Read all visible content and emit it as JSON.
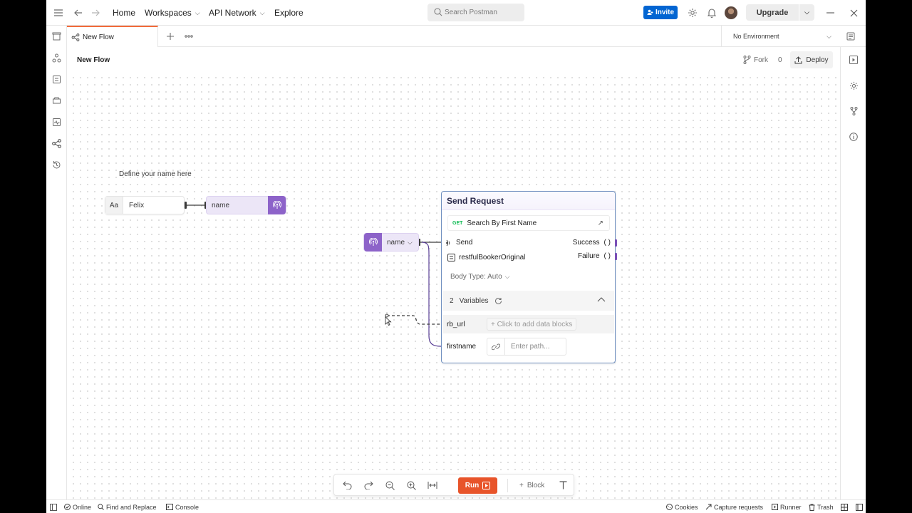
{
  "topbar": {
    "nav": [
      "Home",
      "Workspaces",
      "API Network",
      "Explore"
    ],
    "search_placeholder": "Search Postman",
    "invite_label": "Invite",
    "upgrade_label": "Upgrade"
  },
  "tabs": {
    "active_tab": "New Flow",
    "environment": "No Environment"
  },
  "flow": {
    "title": "New Flow",
    "fork_label": "Fork",
    "fork_count": "0",
    "deploy_label": "Deploy"
  },
  "canvas": {
    "note": "Define your name here",
    "text_block": {
      "type_label": "Aa",
      "value": "Felix"
    },
    "variable_block_1": {
      "label": "name"
    },
    "variable_block_2": {
      "label": "name"
    },
    "send_request": {
      "title": "Send Request",
      "method": "GET",
      "request_name": "Search By First Name",
      "send_label": "Send",
      "success_label": "Success",
      "failure_label": "Failure",
      "environment_label": "restfulBookerOriginal",
      "body_type": "Body Type: Auto",
      "variables_count": "2",
      "variables_label": "Variables",
      "variables": [
        {
          "name": "rb_url",
          "placeholder": "+ Click to add data blocks"
        },
        {
          "name": "firstname",
          "placeholder": "Enter path..."
        }
      ]
    }
  },
  "bottom_toolbar": {
    "run_label": "Run",
    "block_label": "Block"
  },
  "statusbar": {
    "online": "Online",
    "find_replace": "Find and Replace",
    "console": "Console",
    "cookies": "Cookies",
    "capture": "Capture requests",
    "runner": "Runner",
    "trash": "Trash"
  },
  "colors": {
    "accent_orange": "#e8542a",
    "invite_blue": "#0265d2",
    "variable_purple": "#8d63c9",
    "get_green": "#0cbb52"
  }
}
